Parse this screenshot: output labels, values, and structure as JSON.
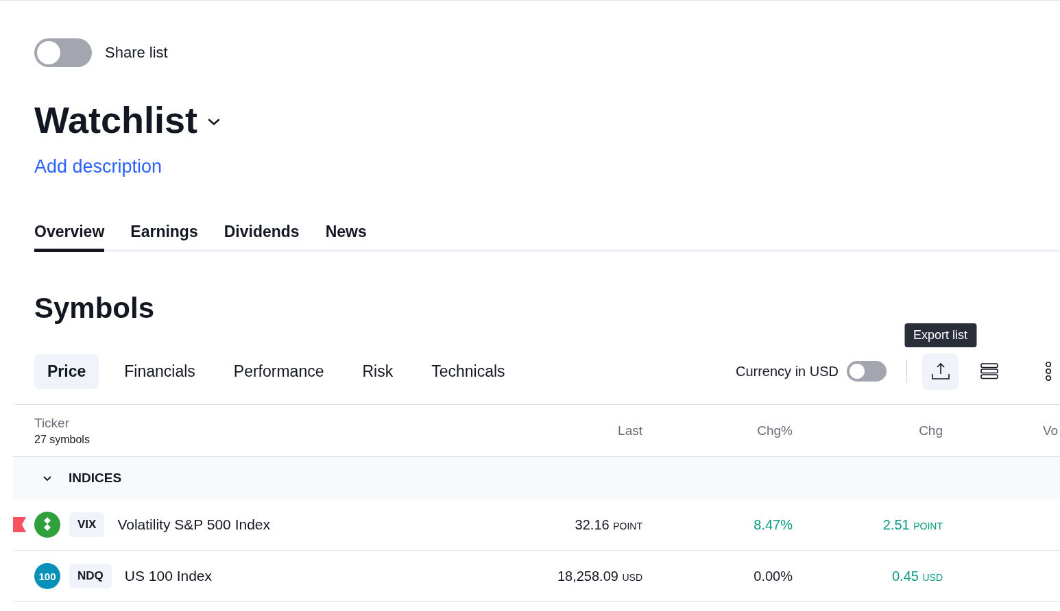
{
  "share_toggle": {
    "label": "Share list",
    "on": false
  },
  "watchlist": {
    "title": "Watchlist",
    "add_description": "Add description"
  },
  "tabs": [
    {
      "label": "Overview",
      "selected": true
    },
    {
      "label": "Earnings",
      "selected": false
    },
    {
      "label": "Dividends",
      "selected": false
    },
    {
      "label": "News",
      "selected": false
    }
  ],
  "section_title": "Symbols",
  "view_tabs": [
    {
      "label": "Price",
      "selected": true
    },
    {
      "label": "Financials",
      "selected": false
    },
    {
      "label": "Performance",
      "selected": false
    },
    {
      "label": "Risk",
      "selected": false
    },
    {
      "label": "Technicals",
      "selected": false
    }
  ],
  "currency_toggle": {
    "label": "Currency in USD",
    "on": false
  },
  "tooltip": "Export list",
  "table": {
    "ticker_header": "Ticker",
    "symbol_count": "27 symbols",
    "columns": [
      "Last",
      "Chg%",
      "Chg",
      "Vo"
    ],
    "groups": [
      {
        "name": "INDICES",
        "expanded": true,
        "rows": [
          {
            "flagged": true,
            "logo": {
              "kind": "diamond",
              "color": "#2fa03b"
            },
            "ticker": "VIX",
            "name": "Volatility S&P 500 Index",
            "last": "32.16",
            "last_unit": "POINT",
            "chg_pct": {
              "text": "8.47%",
              "color": "#089981"
            },
            "chg": {
              "text": "2.51",
              "unit": "POINT",
              "color": "#089981"
            }
          },
          {
            "flagged": false,
            "logo": {
              "kind": "text",
              "text": "100",
              "color": "#0891b8"
            },
            "ticker": "NDQ",
            "name": "US 100 Index",
            "last": "18,258.09",
            "last_unit": "USD",
            "chg_pct": {
              "text": "0.00%",
              "color": "#131722"
            },
            "chg": {
              "text": "0.45",
              "unit": "USD",
              "color": "#089981"
            }
          }
        ]
      }
    ]
  }
}
